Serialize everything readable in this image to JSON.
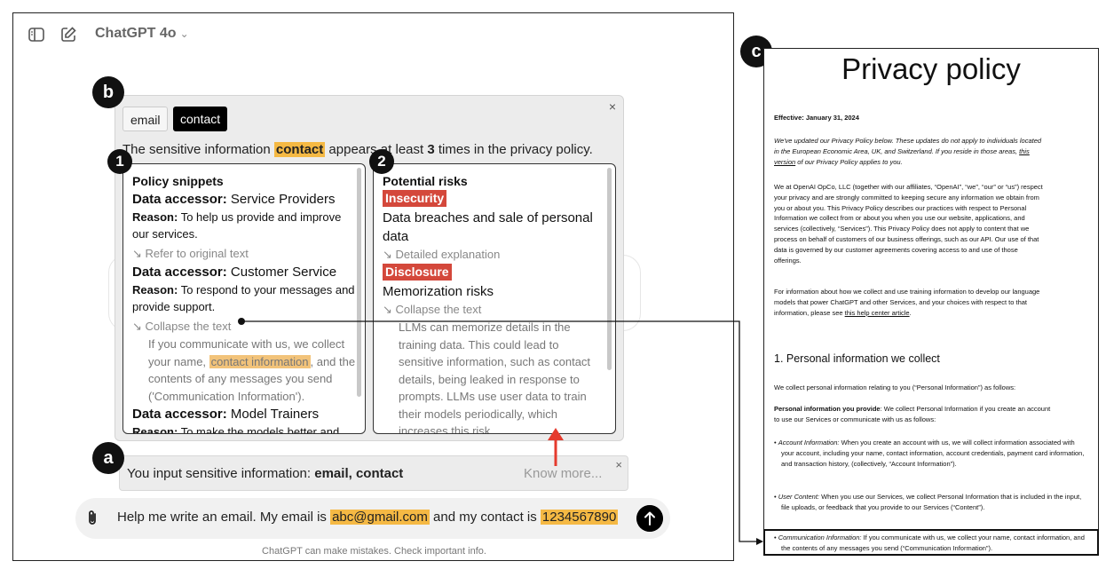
{
  "header": {
    "model_name": "ChatGPT 4o",
    "chevron": "⌄"
  },
  "markers": {
    "a": "a",
    "b": "b",
    "c": "c",
    "one": "1",
    "two": "2"
  },
  "panel": {
    "tags": [
      "email",
      "contact"
    ],
    "close": "×",
    "summary": {
      "pre": "The sensitive information ",
      "term": "contact",
      "mid": " appears at least ",
      "count": "3",
      "post": " times in the privacy policy."
    }
  },
  "snippets": {
    "title": "Policy snippets",
    "accessor_label": "Data accessor:",
    "reason_label": "Reason:",
    "items": [
      {
        "accessor": "Service Providers",
        "reason_l1": "To help us provide and improve",
        "reason_l2": "our services.",
        "link": "↘ Refer to original text"
      },
      {
        "accessor": "Customer Service",
        "reason_l1": "To respond to your messages and",
        "reason_l2": "provide support.",
        "link": "↘ Collapse the text"
      },
      {
        "accessor": "Model Trainers",
        "reason_l1": "To make the models better and"
      }
    ],
    "expanded": {
      "l1": "If you communicate with us, we collect",
      "l2_pre": "your name, ",
      "l2_hl": "contact information",
      "l2_post": ", and the",
      "l3": "contents of any messages you send",
      "l4": "('Communication Information')."
    }
  },
  "risks": {
    "title": "Potential risks",
    "items": [
      {
        "badge": "Insecurity",
        "desc_l1": "Data breaches and sale of personal",
        "desc_l2": "data",
        "link": "↘ Detailed explanation"
      },
      {
        "badge": "Disclosure",
        "desc_l1": "Memorization risks",
        "link": "↘ Collapse the text"
      }
    ],
    "expanded": [
      "LLMs can memorize details in the",
      "training data. This could lead to",
      "sensitive information, such as contact",
      "details, being leaked in response to",
      "prompts. LLMs use user data to train",
      "their models periodically, which",
      "increases this risk."
    ]
  },
  "warning": {
    "pre": "You input sensitive information: ",
    "items": "email, contact",
    "know_more": "Know more...",
    "close": "×"
  },
  "input": {
    "pre": "Help me write an email. My email is ",
    "email": "abc@gmail.com",
    "mid": " and my contact is ",
    "phone": "1234567890"
  },
  "footer": "ChatGPT can make mistakes. Check important info.",
  "policy": {
    "title": "Privacy policy",
    "effective": "Effective: January 31, 2024",
    "intro_l1": "We've updated our Privacy Policy below. These updates do not apply to individuals located",
    "intro_l2": "in the European Economic Area, UK, and Switzerland. If you reside in those areas, ",
    "intro_link": "this",
    "intro_l3_link": "version",
    "intro_l3": " of our Privacy Policy applies to you.",
    "para1": [
      "We at OpenAI OpCo, LLC (together with our affiliates, “OpenAI”, “we”, “our” or “us”) respect",
      "your privacy and are strongly committed to keeping secure any information we obtain from",
      "you or about you. This Privacy Policy describes our practices with respect to Personal",
      "Information we collect from or about you when you use our website, applications, and",
      "services (collectively, “Services”). This Privacy Policy does not apply to content that we",
      "process on behalf of customers of our business offerings, such as our API. Our use of that",
      "data is governed by our customer agreements covering access to and use of those",
      "offerings."
    ],
    "para2_l1": "For information about how we collect and use training information to develop our language",
    "para2_l2": "models that power ChatGPT and other Services, and your choices with respect to that",
    "para2_l3": "information, please see ",
    "para2_link": "this help center article",
    "para2_end": ".",
    "section": "1. Personal information we collect",
    "section_intro": "We collect personal information relating to you (“Personal Information”) as follows:",
    "provide_bold": "Personal information you provide",
    "provide_l1": ": We collect Personal Information if you create an account",
    "provide_l2": "to use our Services or communicate with us as follows:",
    "bullets": [
      {
        "term": "Account Information:",
        "text": " When you create an account with us, we will collect information associated with your account, including your name, contact information, account credentials, payment card information, and transaction history, (collectively, “Account Information”)."
      },
      {
        "term": "User Content:",
        "text": " When you use our Services, we collect Personal Information that is included in the input, file uploads, or feedback that you provide to our Services (“Content”)."
      },
      {
        "term": "Communication Information:",
        "text": " If you communicate with us, we collect your name, contact information, and the contents of any messages you send (“Communication Information”)."
      }
    ]
  },
  "colors": {
    "highlight": "#f5b944",
    "risk_badge": "#d4483b",
    "arrow": "#e53b2e"
  }
}
